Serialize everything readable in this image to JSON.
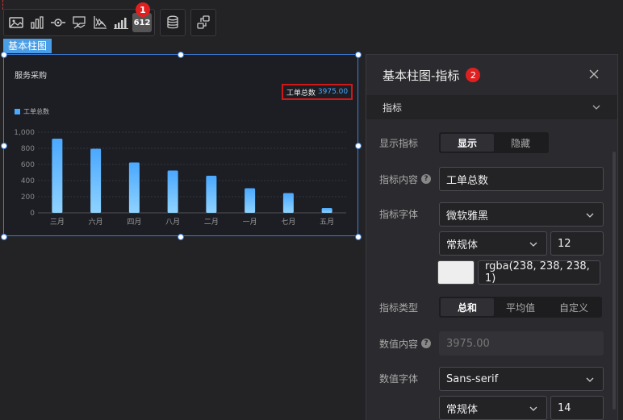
{
  "toolbar": {
    "icons": [
      "image-icon",
      "bar-chart-icon",
      "eye-ring-icon",
      "tooltip-icon",
      "line-axis-icon",
      "column-rising-icon"
    ],
    "number_button": "612",
    "badge_1": "1",
    "database_icon": "database-icon",
    "link_icon": "link-icon"
  },
  "widget": {
    "tag": "基本柱图",
    "title": "服务采购",
    "indicator_label": "工单总数",
    "indicator_value": "3975.00",
    "legend": "工单总数"
  },
  "chart_data": {
    "type": "bar",
    "title": "服务采购",
    "categories": [
      "三月",
      "六月",
      "四月",
      "八月",
      "二月",
      "一月",
      "七月",
      "五月"
    ],
    "series": [
      {
        "name": "工单总数",
        "values": [
          920,
          795,
          625,
          525,
          460,
          305,
          245,
          60
        ]
      }
    ],
    "yticks": [
      "0",
      "200",
      "400",
      "600",
      "800",
      "1,000"
    ],
    "ylim": [
      0,
      1000
    ],
    "grid": true,
    "legend_position": "top-left",
    "bar_color_top": "#4aa8ff",
    "bar_color_bottom": "#8fd3ff"
  },
  "panel": {
    "title": "基本柱图-指标",
    "badge_2": "2",
    "section": "指标",
    "show_label": "显示指标",
    "show_options": [
      "显示",
      "隐藏"
    ],
    "show_selected": "显示",
    "content_label": "指标内容",
    "content_value": "工单总数",
    "font_label": "指标字体",
    "font_family": "微软雅黑",
    "font_style": "常规体",
    "font_size": "12",
    "font_color": "rgba(238, 238, 238, 1)",
    "type_label": "指标类型",
    "type_options": [
      "总和",
      "平均值",
      "自定义"
    ],
    "type_selected": "总和",
    "value_label": "数值内容",
    "value_value": "3975.00",
    "value_font_label": "数值字体",
    "value_font_family": "Sans-serif",
    "value_font_style": "常规体",
    "value_font_size": "14"
  },
  "colors": {
    "accent": "#4a9ee8",
    "highlight_red": "#d01818",
    "panel_bg": "#2b2b2f"
  }
}
